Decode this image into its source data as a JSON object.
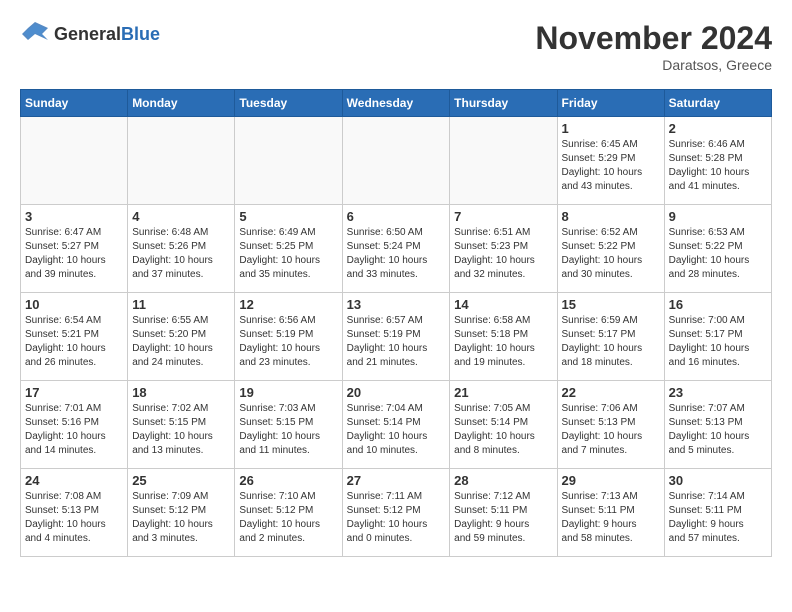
{
  "logo": {
    "text_general": "General",
    "text_blue": "Blue"
  },
  "title": "November 2024",
  "location": "Daratsos, Greece",
  "days_of_week": [
    "Sunday",
    "Monday",
    "Tuesday",
    "Wednesday",
    "Thursday",
    "Friday",
    "Saturday"
  ],
  "weeks": [
    [
      {
        "day": "",
        "info": ""
      },
      {
        "day": "",
        "info": ""
      },
      {
        "day": "",
        "info": ""
      },
      {
        "day": "",
        "info": ""
      },
      {
        "day": "",
        "info": ""
      },
      {
        "day": "1",
        "info": "Sunrise: 6:45 AM\nSunset: 5:29 PM\nDaylight: 10 hours\nand 43 minutes."
      },
      {
        "day": "2",
        "info": "Sunrise: 6:46 AM\nSunset: 5:28 PM\nDaylight: 10 hours\nand 41 minutes."
      }
    ],
    [
      {
        "day": "3",
        "info": "Sunrise: 6:47 AM\nSunset: 5:27 PM\nDaylight: 10 hours\nand 39 minutes."
      },
      {
        "day": "4",
        "info": "Sunrise: 6:48 AM\nSunset: 5:26 PM\nDaylight: 10 hours\nand 37 minutes."
      },
      {
        "day": "5",
        "info": "Sunrise: 6:49 AM\nSunset: 5:25 PM\nDaylight: 10 hours\nand 35 minutes."
      },
      {
        "day": "6",
        "info": "Sunrise: 6:50 AM\nSunset: 5:24 PM\nDaylight: 10 hours\nand 33 minutes."
      },
      {
        "day": "7",
        "info": "Sunrise: 6:51 AM\nSunset: 5:23 PM\nDaylight: 10 hours\nand 32 minutes."
      },
      {
        "day": "8",
        "info": "Sunrise: 6:52 AM\nSunset: 5:22 PM\nDaylight: 10 hours\nand 30 minutes."
      },
      {
        "day": "9",
        "info": "Sunrise: 6:53 AM\nSunset: 5:22 PM\nDaylight: 10 hours\nand 28 minutes."
      }
    ],
    [
      {
        "day": "10",
        "info": "Sunrise: 6:54 AM\nSunset: 5:21 PM\nDaylight: 10 hours\nand 26 minutes."
      },
      {
        "day": "11",
        "info": "Sunrise: 6:55 AM\nSunset: 5:20 PM\nDaylight: 10 hours\nand 24 minutes."
      },
      {
        "day": "12",
        "info": "Sunrise: 6:56 AM\nSunset: 5:19 PM\nDaylight: 10 hours\nand 23 minutes."
      },
      {
        "day": "13",
        "info": "Sunrise: 6:57 AM\nSunset: 5:19 PM\nDaylight: 10 hours\nand 21 minutes."
      },
      {
        "day": "14",
        "info": "Sunrise: 6:58 AM\nSunset: 5:18 PM\nDaylight: 10 hours\nand 19 minutes."
      },
      {
        "day": "15",
        "info": "Sunrise: 6:59 AM\nSunset: 5:17 PM\nDaylight: 10 hours\nand 18 minutes."
      },
      {
        "day": "16",
        "info": "Sunrise: 7:00 AM\nSunset: 5:17 PM\nDaylight: 10 hours\nand 16 minutes."
      }
    ],
    [
      {
        "day": "17",
        "info": "Sunrise: 7:01 AM\nSunset: 5:16 PM\nDaylight: 10 hours\nand 14 minutes."
      },
      {
        "day": "18",
        "info": "Sunrise: 7:02 AM\nSunset: 5:15 PM\nDaylight: 10 hours\nand 13 minutes."
      },
      {
        "day": "19",
        "info": "Sunrise: 7:03 AM\nSunset: 5:15 PM\nDaylight: 10 hours\nand 11 minutes."
      },
      {
        "day": "20",
        "info": "Sunrise: 7:04 AM\nSunset: 5:14 PM\nDaylight: 10 hours\nand 10 minutes."
      },
      {
        "day": "21",
        "info": "Sunrise: 7:05 AM\nSunset: 5:14 PM\nDaylight: 10 hours\nand 8 minutes."
      },
      {
        "day": "22",
        "info": "Sunrise: 7:06 AM\nSunset: 5:13 PM\nDaylight: 10 hours\nand 7 minutes."
      },
      {
        "day": "23",
        "info": "Sunrise: 7:07 AM\nSunset: 5:13 PM\nDaylight: 10 hours\nand 5 minutes."
      }
    ],
    [
      {
        "day": "24",
        "info": "Sunrise: 7:08 AM\nSunset: 5:13 PM\nDaylight: 10 hours\nand 4 minutes."
      },
      {
        "day": "25",
        "info": "Sunrise: 7:09 AM\nSunset: 5:12 PM\nDaylight: 10 hours\nand 3 minutes."
      },
      {
        "day": "26",
        "info": "Sunrise: 7:10 AM\nSunset: 5:12 PM\nDaylight: 10 hours\nand 2 minutes."
      },
      {
        "day": "27",
        "info": "Sunrise: 7:11 AM\nSunset: 5:12 PM\nDaylight: 10 hours\nand 0 minutes."
      },
      {
        "day": "28",
        "info": "Sunrise: 7:12 AM\nSunset: 5:11 PM\nDaylight: 9 hours\nand 59 minutes."
      },
      {
        "day": "29",
        "info": "Sunrise: 7:13 AM\nSunset: 5:11 PM\nDaylight: 9 hours\nand 58 minutes."
      },
      {
        "day": "30",
        "info": "Sunrise: 7:14 AM\nSunset: 5:11 PM\nDaylight: 9 hours\nand 57 minutes."
      }
    ]
  ]
}
